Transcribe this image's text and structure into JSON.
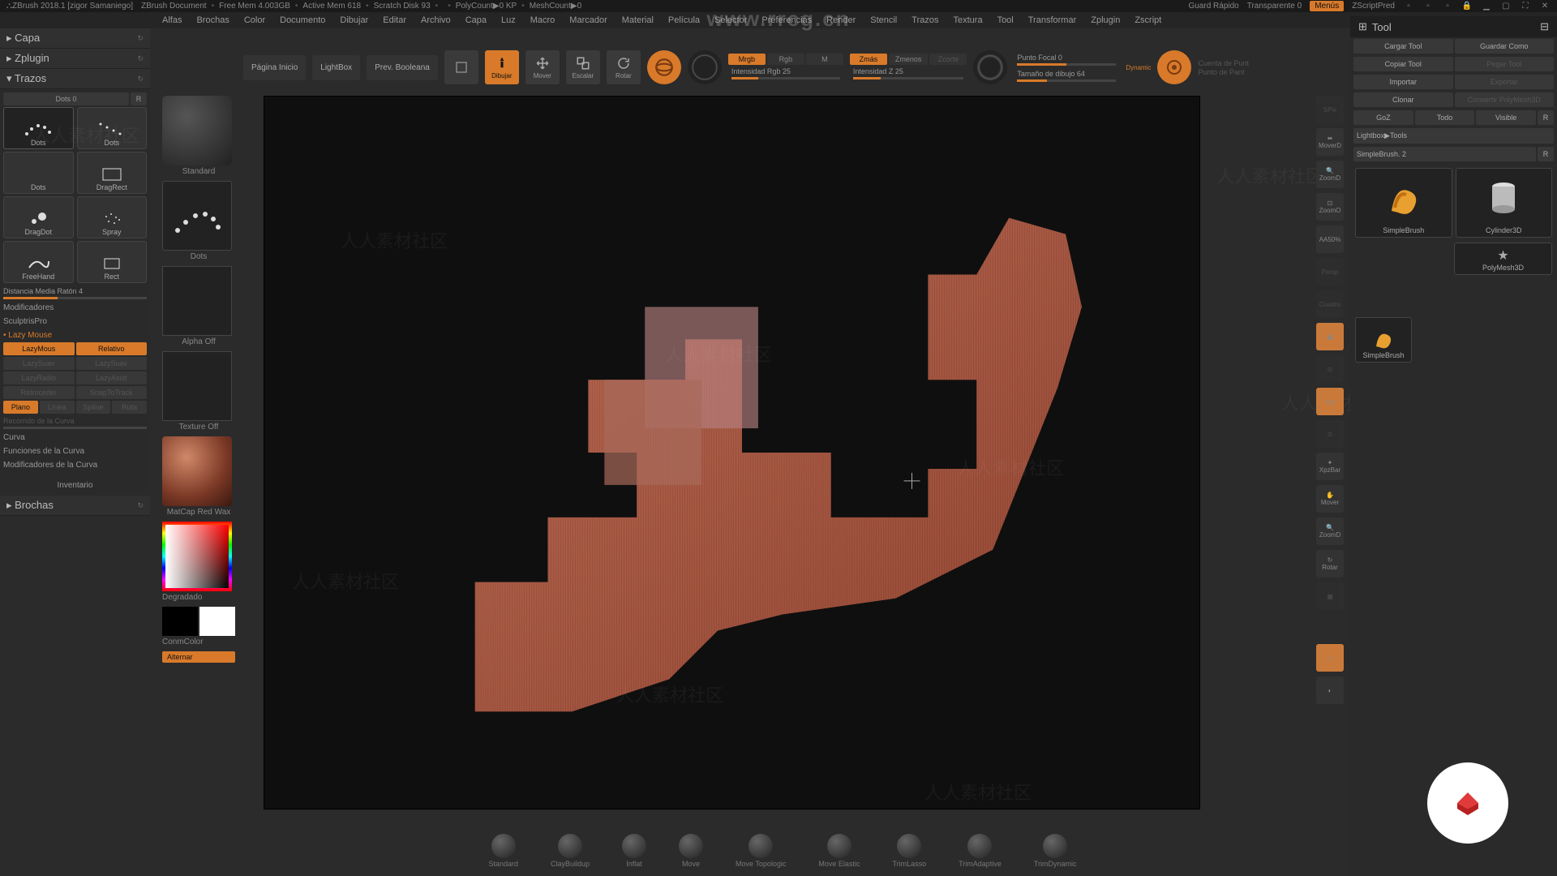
{
  "titlebar": {
    "app": "ZBrush 2018.1 [zigor Samaniego]",
    "doc": "ZBrush Document",
    "freemem": "Free Mem 4.003GB",
    "activemem": "Active Mem 618",
    "scratch": "Scratch Disk 93",
    "polycount": "PolyCount▶0 KP",
    "meshcount": "MeshCount▶0",
    "guard": "Guard Rápido",
    "transparente": "Transparente 0",
    "menus": "Menús",
    "zscript": "ZScriptPred"
  },
  "menubar": [
    "Alfas",
    "Brochas",
    "Color",
    "Documento",
    "Dibujar",
    "Editar",
    "Archivo",
    "Capa",
    "Luz",
    "Macro",
    "Marcador",
    "Material",
    "Película",
    "Selector",
    "Preferencias",
    "Render",
    "Stencil",
    "Trazos",
    "Textura",
    "Tool",
    "Transformar",
    "Zplugin",
    "Zscript"
  ],
  "left": {
    "capa": "Capa",
    "zplugin": "Zplugin",
    "trazos": "Trazos",
    "dots_label": "Dots  0",
    "dots_r": "R",
    "strokes": [
      {
        "name": "Dots"
      },
      {
        "name": "Dots"
      },
      {
        "name": "Dots"
      },
      {
        "name": "DragRect"
      },
      {
        "name": "DragDot"
      },
      {
        "name": "Spray"
      },
      {
        "name": "FreeHand"
      },
      {
        "name": "Rect"
      }
    ],
    "distancia": "Distancia Media Ratón 4",
    "modificadores": "Modificadores",
    "sculptris": "SculptrisPro",
    "lazymouse": "Lazy Mouse",
    "lazy_buttons": [
      [
        "LazyMous",
        "Relativo"
      ],
      [
        "LazySuav",
        "LazySuav"
      ],
      [
        "LazyRadio",
        "LazyAsist"
      ],
      [
        "Retroceder",
        "SnapToTrack"
      ],
      [
        "Plano",
        "Línea",
        "Spline",
        "Ruta"
      ]
    ],
    "recorrido": "Recorrido de la Curva",
    "curva": "Curva",
    "funciones": "Funciones de la Curva",
    "modcurva": "Modificadores de la Curva",
    "inventario": "Inventario",
    "brochas": "Brochas"
  },
  "brushcol": {
    "standard": "Standard",
    "dots": "Dots",
    "alpha": "Alpha Off",
    "texture": "Texture Off",
    "material": "MatCap Red Wax",
    "degradado": "Degradado",
    "conmcolor": "ConmColor",
    "alternar": "Alternar"
  },
  "shelf": {
    "pagina": "Página Inicio",
    "lightbox": "LightBox",
    "prev": "Prev. Booleana",
    "dibujar": "Dibujar",
    "mover": "Mover",
    "escalar": "Escalar",
    "rotar": "Rotar",
    "mrgb": "Mrgb",
    "rgb": "Rgb",
    "m": "M",
    "intensidad_rgb": "Intensidad Rgb 25",
    "zmas": "Zmás",
    "zmenos": "Zmenos",
    "zcorte": "Zcorte",
    "intensidad_z": "Intensidad Z 25",
    "punto_focal": "Punto Focal 0",
    "tamano": "Tamaño de dibujo 64",
    "dynamic": "Dynamic",
    "cuenta": "Cuenta de Punt",
    "cuenta2": "Punto de Pant"
  },
  "rightrail": [
    "SPix",
    "MoverD",
    "ZoomD",
    "ZoomO",
    "AA50%",
    "Persp",
    "Cuadro",
    "▦",
    "⊙",
    "⊙",
    "XpzBar",
    "Mover",
    "ZoomD",
    "Rotar",
    "▦",
    "",
    "",
    "",
    ""
  ],
  "tool": {
    "title": "Tool",
    "rows": [
      [
        "Cargar Tool",
        "Guardar Como"
      ],
      [
        "Copiar Tool",
        "Pegar Tool"
      ],
      [
        "Importar",
        "Exportar"
      ],
      [
        "Clonar",
        "Convertir PolyMesh3D"
      ],
      [
        "GoZ",
        "Todo",
        "Visible",
        "R"
      ]
    ],
    "lightbox": "Lightbox▶Tools",
    "simple": "SimpleBrush. 2",
    "r": "R",
    "thumbs": [
      {
        "name": "SimpleBrush"
      },
      {
        "name": "Cylinder3D"
      },
      {
        "name": "PolyMesh3D"
      }
    ],
    "small": "SimpleBrush"
  },
  "tray": [
    "Standard",
    "ClayBuildup",
    "Inflat",
    "Move",
    "Move Topologic",
    "Move Elastic",
    "TrimLasso",
    "TrimAdaptive",
    "TrimDynamic"
  ],
  "watermark_url": "www.rrcg.cn",
  "wm_text": "人人素材社区"
}
